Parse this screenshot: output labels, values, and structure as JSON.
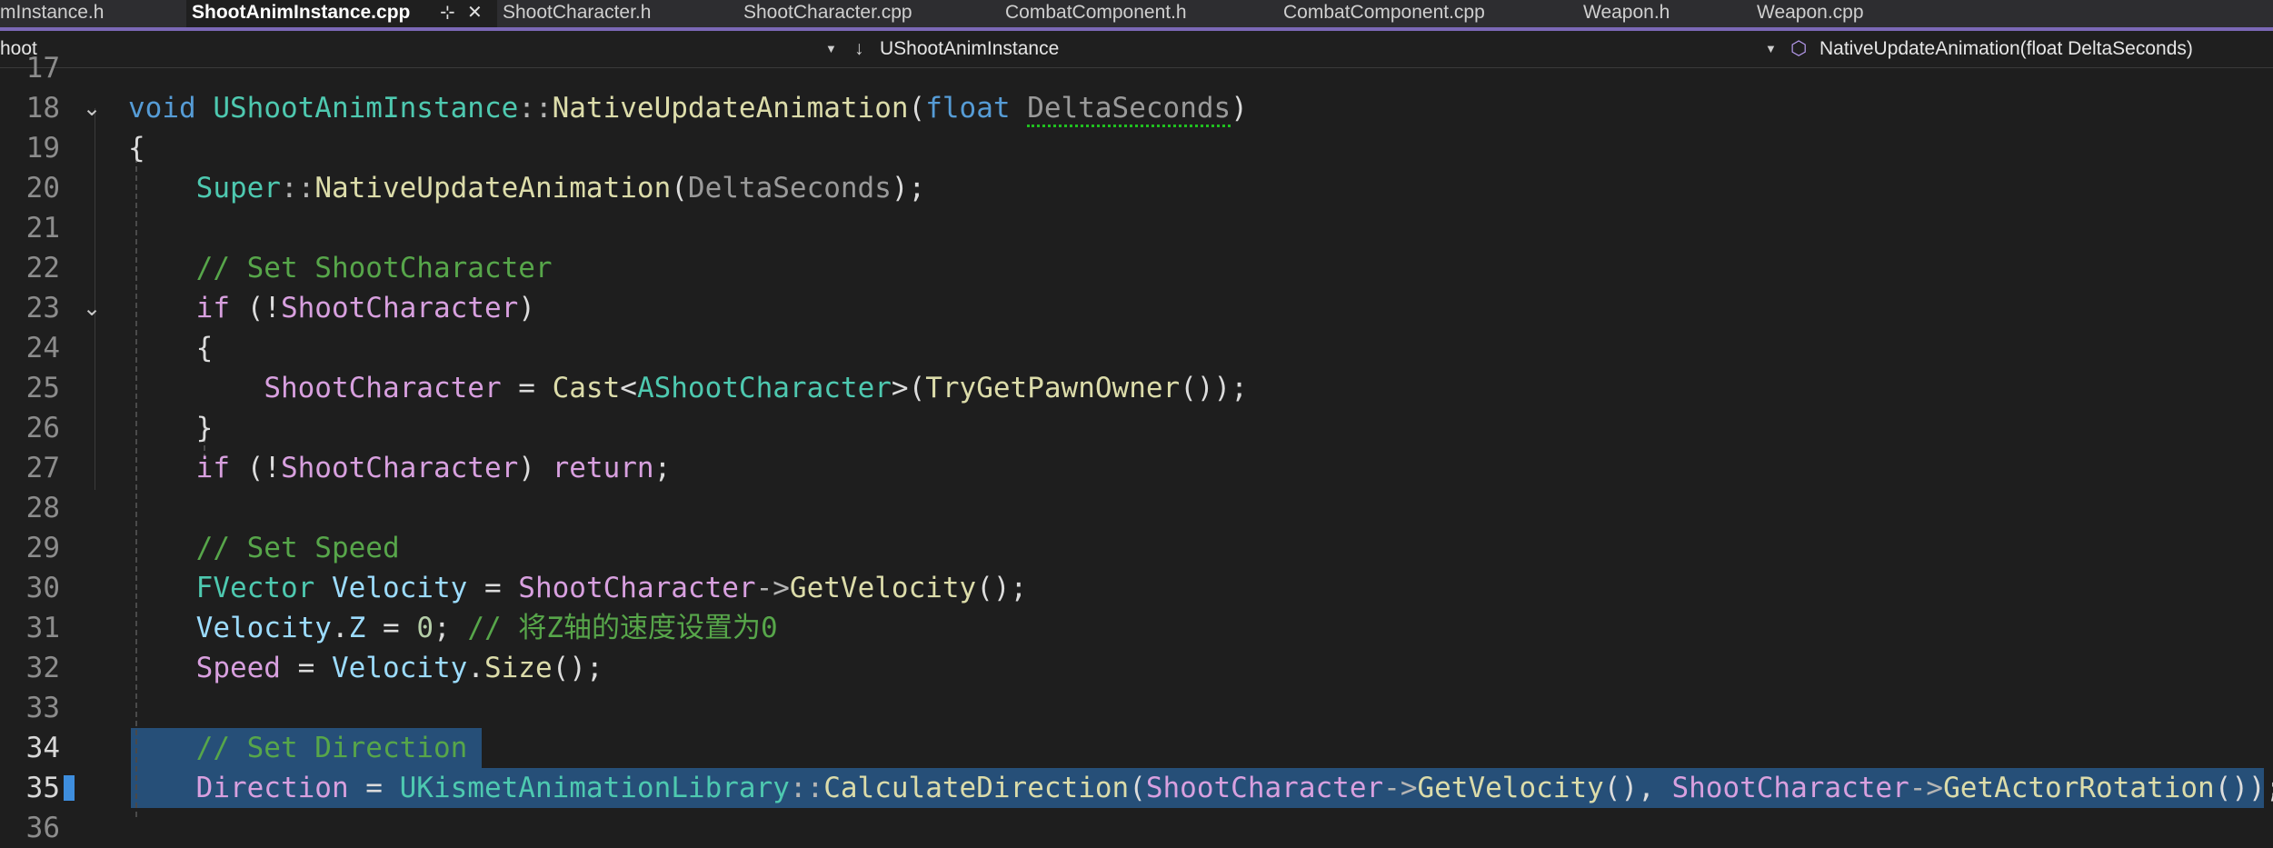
{
  "tabs": [
    {
      "label": "mInstance.h"
    },
    {
      "label": "ShootAnimInstance.cpp"
    },
    {
      "label": "ShootCharacter.h"
    },
    {
      "label": "ShootCharacter.cpp"
    },
    {
      "label": "CombatComponent.h"
    },
    {
      "label": "CombatComponent.cpp"
    },
    {
      "label": "Weapon.h"
    },
    {
      "label": "Weapon.cpp"
    }
  ],
  "tab_icons": {
    "pin": "⊹",
    "close": "✕"
  },
  "navbar": {
    "project": "hoot",
    "class_icon": "↓",
    "class": "UShootAnimInstance",
    "member_icon": "⬡",
    "member": "NativeUpdateAnimation(float DeltaSeconds)"
  },
  "lines": [
    {
      "num": "17",
      "tokens": []
    },
    {
      "num": "18",
      "tokens": [
        {
          "t": "void",
          "c": "kw"
        },
        {
          "t": " ",
          "c": ""
        },
        {
          "t": "UShootAnimInstance",
          "c": "ty"
        },
        {
          "t": "::",
          "c": "op"
        },
        {
          "t": "NativeUpdateAnimation",
          "c": "fn"
        },
        {
          "t": "(",
          "c": ""
        },
        {
          "t": "float",
          "c": "kw"
        },
        {
          "t": " ",
          "c": ""
        },
        {
          "t": "DeltaSeconds",
          "c": "par squig"
        },
        {
          "t": ")",
          "c": ""
        }
      ]
    },
    {
      "num": "19",
      "tokens": [
        {
          "t": "{",
          "c": ""
        }
      ]
    },
    {
      "num": "20",
      "tokens": [
        {
          "t": "    ",
          "c": ""
        },
        {
          "t": "Super",
          "c": "ty"
        },
        {
          "t": "::",
          "c": "op"
        },
        {
          "t": "NativeUpdateAnimation",
          "c": "fn"
        },
        {
          "t": "(",
          "c": ""
        },
        {
          "t": "DeltaSeconds",
          "c": "par"
        },
        {
          "t": ");",
          "c": ""
        }
      ]
    },
    {
      "num": "21",
      "tokens": []
    },
    {
      "num": "22",
      "tokens": [
        {
          "t": "    ",
          "c": ""
        },
        {
          "t": "// Set ShootCharacter",
          "c": "cm"
        }
      ]
    },
    {
      "num": "23",
      "tokens": [
        {
          "t": "    ",
          "c": ""
        },
        {
          "t": "if",
          "c": "ctl"
        },
        {
          "t": " (!",
          "c": ""
        },
        {
          "t": "ShootCharacter",
          "c": "ctl"
        },
        {
          "t": ")",
          "c": ""
        }
      ]
    },
    {
      "num": "24",
      "tokens": [
        {
          "t": "    {",
          "c": ""
        }
      ]
    },
    {
      "num": "25",
      "tokens": [
        {
          "t": "        ",
          "c": ""
        },
        {
          "t": "ShootCharacter",
          "c": "ctl"
        },
        {
          "t": " = ",
          "c": ""
        },
        {
          "t": "Cast",
          "c": "fn"
        },
        {
          "t": "<",
          "c": ""
        },
        {
          "t": "AShootCharacter",
          "c": "ty"
        },
        {
          "t": ">(",
          "c": ""
        },
        {
          "t": "TryGetPawnOwner",
          "c": "fn"
        },
        {
          "t": "());",
          "c": ""
        }
      ]
    },
    {
      "num": "26",
      "tokens": [
        {
          "t": "    }",
          "c": ""
        }
      ]
    },
    {
      "num": "27",
      "tokens": [
        {
          "t": "    ",
          "c": ""
        },
        {
          "t": "if",
          "c": "ctl"
        },
        {
          "t": " (!",
          "c": ""
        },
        {
          "t": "ShootCharacter",
          "c": "ctl"
        },
        {
          "t": ") ",
          "c": ""
        },
        {
          "t": "return",
          "c": "ctl"
        },
        {
          "t": ";",
          "c": ""
        }
      ]
    },
    {
      "num": "28",
      "tokens": []
    },
    {
      "num": "29",
      "tokens": [
        {
          "t": "    ",
          "c": ""
        },
        {
          "t": "// Set Speed",
          "c": "cm"
        }
      ]
    },
    {
      "num": "30",
      "tokens": [
        {
          "t": "    ",
          "c": ""
        },
        {
          "t": "FVector",
          "c": "ty"
        },
        {
          "t": " ",
          "c": ""
        },
        {
          "t": "Velocity",
          "c": "var"
        },
        {
          "t": " = ",
          "c": ""
        },
        {
          "t": "ShootCharacter",
          "c": "ctl"
        },
        {
          "t": "->",
          "c": "op"
        },
        {
          "t": "GetVelocity",
          "c": "fn"
        },
        {
          "t": "();",
          "c": ""
        }
      ]
    },
    {
      "num": "31",
      "tokens": [
        {
          "t": "    ",
          "c": ""
        },
        {
          "t": "Velocity",
          "c": "var"
        },
        {
          "t": ".",
          "c": ""
        },
        {
          "t": "Z",
          "c": "var"
        },
        {
          "t": " = ",
          "c": ""
        },
        {
          "t": "0",
          "c": "num"
        },
        {
          "t": "; ",
          "c": ""
        },
        {
          "t": "// 将Z轴的速度设置为0",
          "c": "cm"
        }
      ]
    },
    {
      "num": "32",
      "tokens": [
        {
          "t": "    ",
          "c": ""
        },
        {
          "t": "Speed",
          "c": "ctl"
        },
        {
          "t": " = ",
          "c": ""
        },
        {
          "t": "Velocity",
          "c": "var"
        },
        {
          "t": ".",
          "c": ""
        },
        {
          "t": "Size",
          "c": "fn"
        },
        {
          "t": "();",
          "c": ""
        }
      ]
    },
    {
      "num": "33",
      "tokens": []
    },
    {
      "num": "34",
      "tokens": [
        {
          "t": "    ",
          "c": ""
        },
        {
          "t": "// Set Direction",
          "c": "cm"
        }
      ]
    },
    {
      "num": "35",
      "tokens": [
        {
          "t": "    ",
          "c": ""
        },
        {
          "t": "Direction",
          "c": "ctl"
        },
        {
          "t": " = ",
          "c": ""
        },
        {
          "t": "UKismetAnimationLibrary",
          "c": "ty"
        },
        {
          "t": "::",
          "c": "op"
        },
        {
          "t": "CalculateDirection",
          "c": "fn"
        },
        {
          "t": "(",
          "c": ""
        },
        {
          "t": "ShootCharacter",
          "c": "ctl"
        },
        {
          "t": "->",
          "c": "op"
        },
        {
          "t": "GetVelocity",
          "c": "fn"
        },
        {
          "t": "(), ",
          "c": ""
        },
        {
          "t": "ShootCharacter",
          "c": "ctl"
        },
        {
          "t": "->",
          "c": "op"
        },
        {
          "t": "GetActorRotation",
          "c": "fn"
        },
        {
          "t": "());",
          "c": ""
        }
      ]
    },
    {
      "num": "36",
      "tokens": []
    }
  ],
  "fold_icon": "⌄",
  "colors": {
    "accent": "#7b68b6",
    "selection": "#264f78",
    "comment": "#57a64a"
  }
}
